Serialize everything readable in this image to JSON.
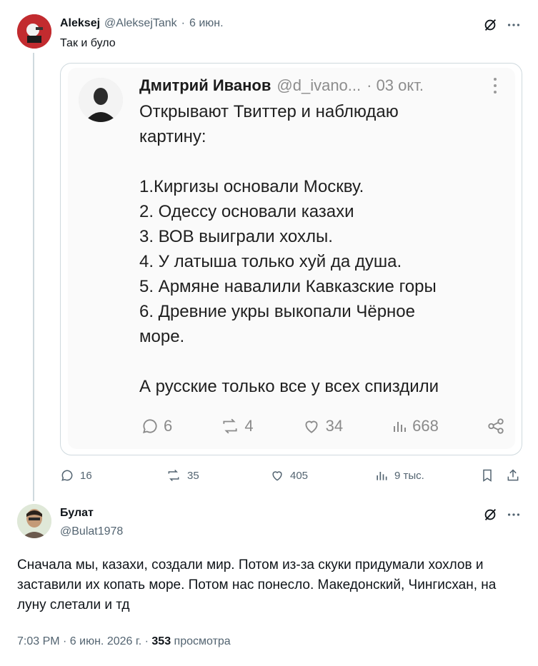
{
  "post": {
    "author_name": "Aleksej",
    "author_handle": "@AleksejTank",
    "date": "6 июн.",
    "text": "Так и було"
  },
  "quoted": {
    "author_name": "Дмитрий Иванов",
    "author_handle": "@d_ivano...",
    "date": "· 03 окт.",
    "text": "Открывают Твиттер и наблюдаю\nкартину:\n\n1.Киргизы основали Москву.\n2. Одессу основали казахи\n3. ВОВ выиграли хохлы.\n4. У латыша только хуй да душа.\n5. Армяне навалили Кавказские горы\n6. Древние укры выкопали Чёрное\nморе.\n\nА русские только все у всех спиздили",
    "replies": "6",
    "reposts": "4",
    "likes": "34",
    "views": "668"
  },
  "post_stats": {
    "replies": "16",
    "reposts": "35",
    "likes": "405",
    "views": "9 тыс."
  },
  "reply": {
    "author_name": "Булат",
    "author_handle": "@Bulat1978",
    "text": "Сначала мы, казахи, создали мир. Потом из-за скуки придумали хохлов и заставили их копать море. Потом нас понесло. Македонский, Чингисхан, на луну слетали и тд",
    "time": "7:03 PM · 6 июн. 2026 г. · ",
    "views_count": "353",
    "views_label": " просмотра"
  },
  "icons": {
    "grok": "grok-icon",
    "more": "more-icon",
    "reply": "reply-icon",
    "repost": "repost-icon",
    "like": "like-icon",
    "views": "views-icon",
    "bookmark": "bookmark-icon",
    "share": "share-icon"
  },
  "colors": {
    "text": "#0f1419",
    "muted": "#536471",
    "border": "#cfd9de"
  }
}
